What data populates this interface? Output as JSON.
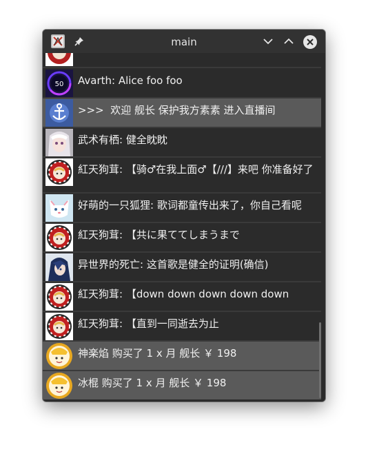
{
  "window": {
    "title": "main",
    "icons": [
      "app-icon",
      "pin-icon",
      "chevron-down-icon",
      "chevron-up-icon",
      "close-icon"
    ]
  },
  "badge": {
    "level": "50"
  },
  "messages": [
    {
      "text": "",
      "avatar": "partial-avatar",
      "highlight": false
    },
    {
      "text": "Avarth: Alice foo foo",
      "avatar": "level-ring-avatar",
      "highlight": false
    },
    {
      "text": ">>>  欢迎 舰长 保护我方素素 进入直播间",
      "avatar": "anchor-badge-avatar",
      "highlight": true
    },
    {
      "text": "武术有栖: 健全眈眈",
      "avatar": "anime-girl-avatar",
      "highlight": false
    },
    {
      "text": "紅天狗茸: 【骑♂在我上面♂【///】来吧 你准备好了",
      "avatar": "tengu-avatar",
      "highlight": false
    },
    {
      "text": "好萌的一只狐狸: 歌词都童传出来了，你自己看呢",
      "avatar": "fox-avatar",
      "highlight": false
    },
    {
      "text": "紅天狗茸: 【共に果ててしまうまで",
      "avatar": "tengu-avatar",
      "highlight": false
    },
    {
      "text": "异世界的死亡: 这首歌是健全的证明(确信)",
      "avatar": "blue-hair-avatar",
      "highlight": false
    },
    {
      "text": "紅天狗茸: 【down down down down down",
      "avatar": "tengu-avatar",
      "highlight": false
    },
    {
      "text": "紅天狗茸: 【直到一同逝去为止",
      "avatar": "tengu-avatar",
      "highlight": false
    },
    {
      "text": "神楽焰 购买了 1 x 月 舰长 ￥ 198",
      "avatar": "captain-avatar",
      "highlight": true
    },
    {
      "text": "冰棍 购买了 1 x 月 舰长 ￥ 198",
      "avatar": "captain-avatar",
      "highlight": true
    }
  ],
  "colors": {
    "background": "#2b2b2b",
    "highlight_row": "#5a5a5a",
    "text": "#f0f0f0",
    "titlebar": "#323232"
  }
}
